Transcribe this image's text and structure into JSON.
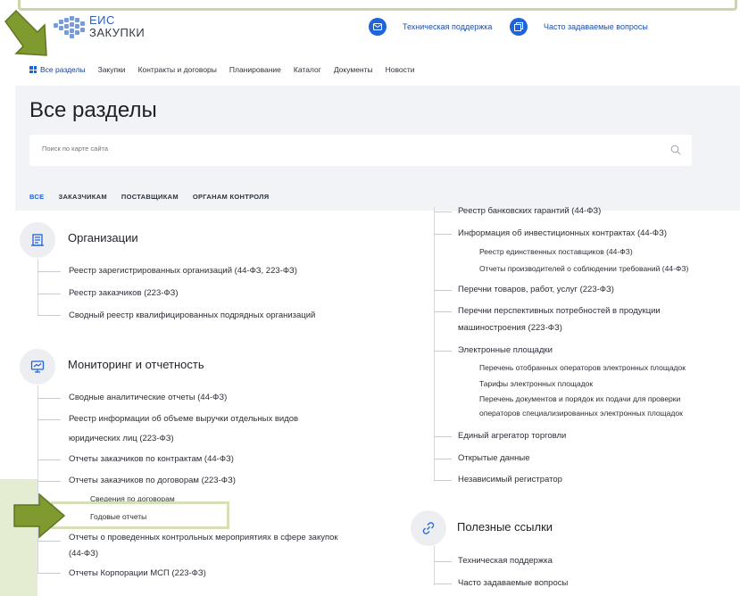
{
  "header": {
    "logo_line1": "ЕИС",
    "logo_line2": "ЗАКУПКИ",
    "support": "Техническая поддержка",
    "faq": "Часто задаваемые вопросы"
  },
  "nav": {
    "items": [
      "Все разделы",
      "Закупки",
      "Контракты и договоры",
      "Планирование",
      "Каталог",
      "Документы",
      "Новости"
    ]
  },
  "page": {
    "title": "Все разделы",
    "search_placeholder": "Поиск по карте сайта"
  },
  "filters": [
    "ВСЕ",
    "ЗАКАЗЧИКАМ",
    "ПОСТАВЩИКАМ",
    "ОРГАНАМ КОНТРОЛЯ"
  ],
  "left": {
    "org_title": "Организации",
    "org_links": [
      "Реестр зарегистрированных организаций (44-ФЗ, 223-ФЗ)",
      "Реестр заказчиков (223-ФЗ)",
      "Сводный реестр квалифицированных подрядных организаций"
    ],
    "mon_title": "Мониторинг и отчетность",
    "mon_links": [
      "Сводные аналитические отчеты (44-ФЗ)",
      "Реестр информации об объеме выручки отдельных видов",
      "юридических лиц (223-ФЗ)",
      "Отчеты заказчиков по контрактам (44-ФЗ)",
      "Отчеты заказчиков по договорам (223-ФЗ)"
    ],
    "mon_sub": [
      "Сведения по договорам",
      "Годовые отчеты"
    ],
    "mon_links2": [
      "Отчеты о проведенных контрольных мероприятиях в сфере закупок",
      "(44-ФЗ)",
      "Отчеты Корпорации МСП (223-ФЗ)"
    ]
  },
  "right": {
    "links": [
      "Реестр банковских гарантий (44-ФЗ)",
      "Информация об инвестиционных контрактах (44-ФЗ)",
      "Реестр единственных поставщиков (44-ФЗ)",
      "Отчеты производителей о соблюдении требований (44-ФЗ)",
      "Перечни товаров, работ, услуг (223-ФЗ)",
      "Перечни перспективных потребностей в продукции",
      "машиностроения (223-ФЗ)",
      "Электронные площадки",
      "Перечень отобранных операторов электронных площадок",
      "Тарифы электронных площадок",
      "Перечень документов и порядок их подачи для проверки",
      "операторов специализированных электронных площадок",
      "Единый агрегатор торговли",
      "Открытые данные",
      "Независимый регистратор"
    ],
    "useful_title": "Полезные ссылки",
    "useful_links": [
      "Техническая поддержка",
      "Часто задаваемые вопросы"
    ]
  },
  "colors": {
    "accent": "#1f64d8",
    "highlight": "#d5e0b5",
    "arrow": "#7f9a2e"
  }
}
